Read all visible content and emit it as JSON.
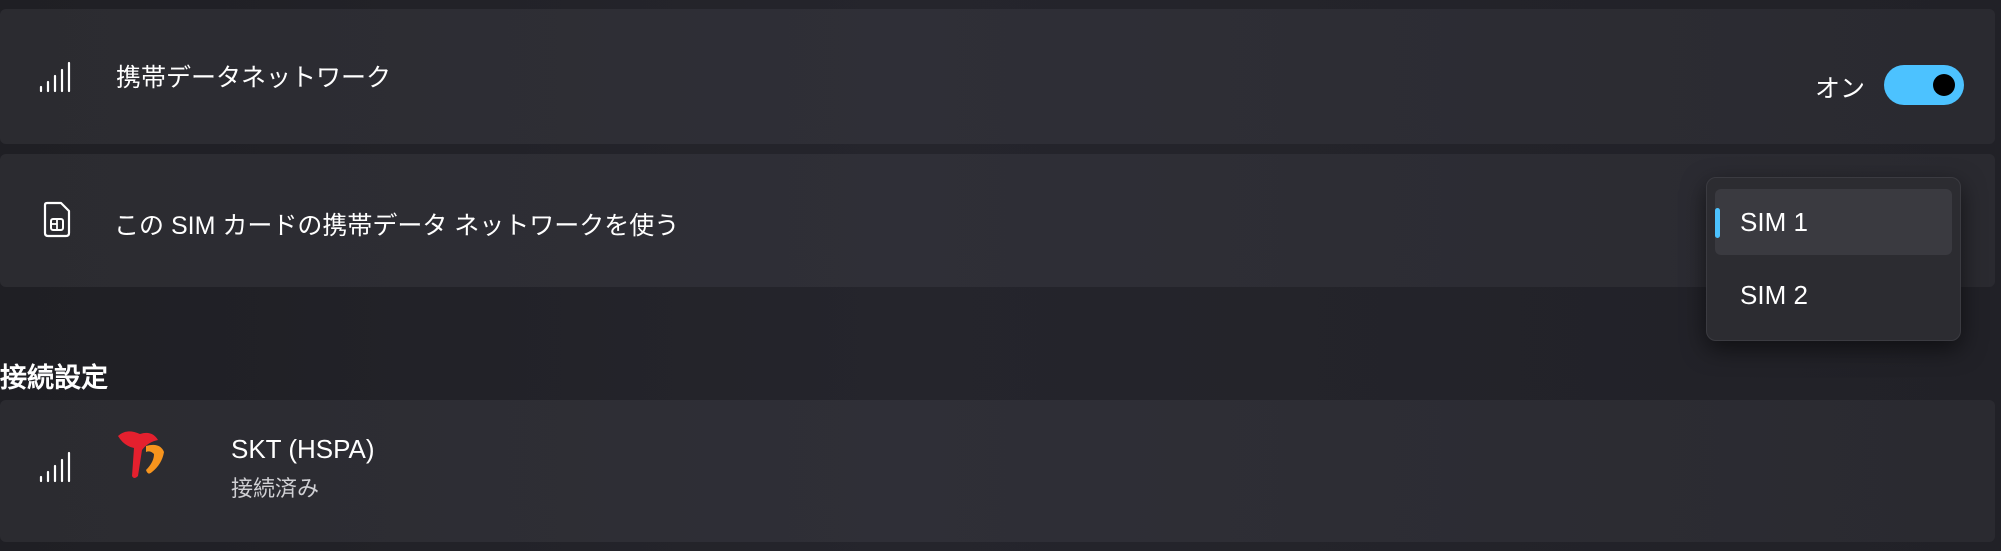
{
  "cellular": {
    "label": "携帯データネットワーク",
    "toggle_state": "オン",
    "toggle_on": true
  },
  "sim_card": {
    "label": "この SIM カードの携帯データ ネットワークを使う",
    "options": [
      "SIM 1",
      "SIM 2"
    ],
    "selected": "SIM 1"
  },
  "connection_settings": {
    "title": "接続設定",
    "carrier_name": "SKT (HSPA)",
    "status": "接続済み"
  },
  "colors": {
    "accent": "#4cc2ff",
    "card": "#2d2d33",
    "carrier_logo_red": "#e4202e",
    "carrier_logo_orange": "#f7941d"
  },
  "icons": {
    "signal": "signal-bars-icon",
    "sim": "sim-card-icon",
    "carrier": "skt-logo-icon"
  }
}
